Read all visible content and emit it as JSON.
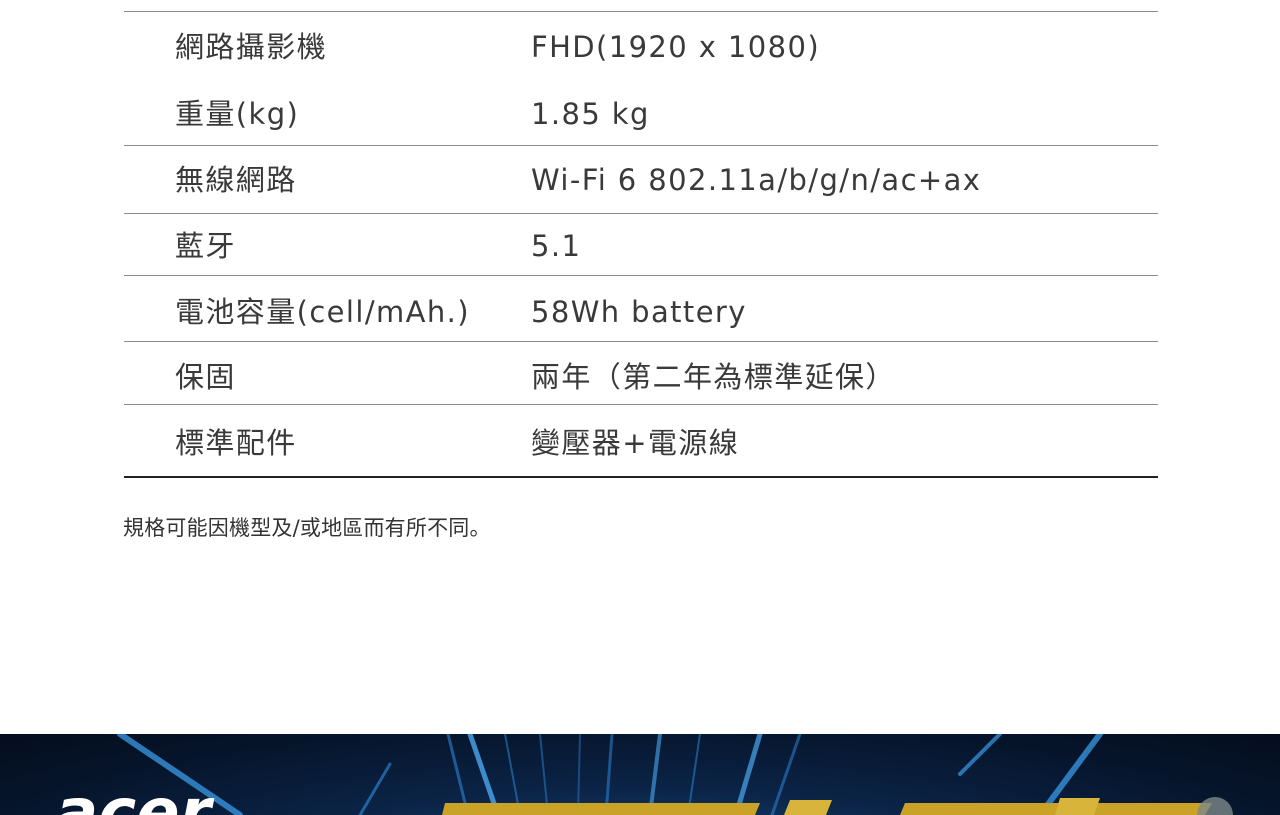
{
  "specs": [
    {
      "label": "網路攝影機",
      "value": "FHD(1920 x 1080)"
    },
    {
      "label": "重量(kg)",
      "value": "1.85 kg"
    },
    {
      "label": "無線網路",
      "value": "Wi-Fi 6 802.11a/b/g/n/ac+ax"
    },
    {
      "label": "藍牙",
      "value": "5.1"
    },
    {
      "label": "電池容量(cell/mAh.)",
      "value": "58Wh battery"
    },
    {
      "label": "保固",
      "value": "兩年（第二年為標準延保）"
    },
    {
      "label": "標準配件",
      "value": "變壓器+電源線"
    }
  ],
  "note": "規格可能因機型及/或地區而有所不同。",
  "banner": {
    "logo_text": "acer",
    "colors": {
      "background": "#06152c",
      "ray": "#2f8fe0",
      "gold": "#c9a227",
      "logo": "#ffffff"
    }
  }
}
